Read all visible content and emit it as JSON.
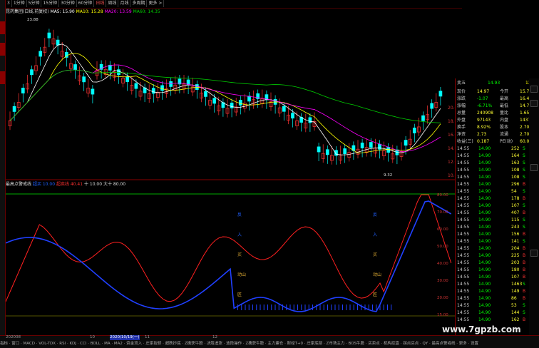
{
  "tabs": [
    "3",
    "1分钟",
    "5分钟",
    "15分钟",
    "30分钟",
    "60分钟",
    "日线",
    "周线",
    "月线",
    "多周期",
    "更多 >"
  ],
  "active_tab": "日线",
  "main_header": {
    "title": "昆药集团(日线,前复权)",
    "ma5": "MA5: 15.90",
    "ma10": "MA10: 15.28",
    "ma20": "MA20: 13.59",
    "ma60": "MA60: 14.35"
  },
  "price_axis": [
    "20.00",
    "18.00",
    "16.00",
    "14.00",
    "12.00",
    "10.00"
  ],
  "max_label": "23.88",
  "min_label": "9.32",
  "indicator_header": {
    "name": "最高点警戒线",
    "a": "超买 10.00",
    "b": "超卖线 40.41",
    "c": "十 10.00",
    "d": "大十 80.00"
  },
  "ind_axis": [
    "80.00",
    "70.00",
    "60.00",
    "50.00",
    "40.00",
    "30.00",
    "20.00",
    "15.00"
  ],
  "signals_left": [
    "反",
    "入",
    "买",
    "动山",
    "匠"
  ],
  "signals_right": [
    "反",
    "入",
    "买",
    "动山",
    "匠"
  ],
  "quote": {
    "sell5": {
      "label": "卖五",
      "price": "14.93",
      "vol": "13"
    },
    "rows": [
      {
        "k1": "现价",
        "v1": "14.97",
        "k2": "今开",
        "v2": "15.70"
      },
      {
        "k1": "涨跌",
        "v1": "-1.07",
        "k2": "最高",
        "v2": "16.40"
      },
      {
        "k1": "涨幅",
        "v1": "-6.71%",
        "k2": "最低",
        "v2": "14.70"
      },
      {
        "k1": "总量",
        "v1": "240908",
        "k2": "量比",
        "v2": "1.65"
      },
      {
        "k1": "外盘",
        "v1": "97143",
        "k2": "内盘",
        "v2": "143765"
      },
      {
        "k1": "换手",
        "v1": "8.92%",
        "k2": "股本",
        "v2": "2.70亿"
      },
      {
        "k1": "净资",
        "v1": "2.73",
        "k2": "流通",
        "v2": "2.70亿"
      },
      {
        "k1": "收益(三)",
        "v1": "0.187",
        "k2": "PE(动)",
        "v2": "60.0"
      }
    ],
    "ticks": [
      {
        "t": "14:55",
        "p": "14.90",
        "v": "252",
        "d": "S",
        "n": "5"
      },
      {
        "t": "14:55",
        "p": "14.90",
        "v": "164",
        "d": "S",
        "n": "8"
      },
      {
        "t": "14:55",
        "p": "14.90",
        "v": "163",
        "d": "S",
        "n": "8"
      },
      {
        "t": "14:55",
        "p": "14.90",
        "v": "108",
        "d": "S",
        "n": "3"
      },
      {
        "t": "14:55",
        "p": "14.90",
        "v": "108",
        "d": "S",
        "n": "9"
      },
      {
        "t": "14:55",
        "p": "14.90",
        "v": "296",
        "d": "B",
        "n": "7"
      },
      {
        "t": "14:55",
        "p": "14.90",
        "v": "54",
        "d": "S",
        "n": "8"
      },
      {
        "t": "14:55",
        "p": "14.90",
        "v": "178",
        "d": "B",
        "n": "7"
      },
      {
        "t": "14:55",
        "p": "14.90",
        "v": "107",
        "d": "S",
        "n": "3"
      },
      {
        "t": "14:55",
        "p": "14.90",
        "v": "407",
        "d": "B",
        "n": "7"
      },
      {
        "t": "14:55",
        "p": "14.90",
        "v": "115",
        "d": "S",
        "n": "7"
      },
      {
        "t": "14:55",
        "p": "14.90",
        "v": "243",
        "d": "S",
        "n": "9"
      },
      {
        "t": "14:55",
        "p": "14.90",
        "v": "156",
        "d": "B",
        "n": "5"
      },
      {
        "t": "14:55",
        "p": "14.90",
        "v": "141",
        "d": "S",
        "n": "8"
      },
      {
        "t": "14:55",
        "p": "14.90",
        "v": "204",
        "d": "B",
        "n": "1"
      },
      {
        "t": "14:55",
        "p": "14.90",
        "v": "225",
        "d": "B",
        "n": "8"
      },
      {
        "t": "14:55",
        "p": "14.90",
        "v": "203",
        "d": "B",
        "n": "3"
      },
      {
        "t": "14:55",
        "p": "14.90",
        "v": "180",
        "d": "B",
        "n": "1"
      },
      {
        "t": "14:55",
        "p": "14.90",
        "v": "107",
        "d": "B",
        "n": "1"
      },
      {
        "t": "14:55",
        "p": "14.90",
        "v": "1463",
        "d": "S",
        "n": "5"
      },
      {
        "t": "14:55",
        "p": "14.90",
        "v": "149",
        "d": "B",
        "n": "6"
      },
      {
        "t": "14:55",
        "p": "14.90",
        "v": "86",
        "d": "B",
        "n": "5"
      },
      {
        "t": "14:55",
        "p": "14.90",
        "v": "53",
        "d": "S",
        "n": "5"
      },
      {
        "t": "14:55",
        "p": "14.90",
        "v": "144",
        "d": "S",
        "n": "1"
      },
      {
        "t": "14:55",
        "p": "14.90",
        "v": "162",
        "d": "B",
        "n": "6"
      }
    ]
  },
  "date_axis": [
    "202008",
    "10",
    "11",
    "12",
    "2020/10/19(一)"
  ],
  "toolbar": "指标 · 窗口 · MACD · VOL-TDX · RSI · KDJ · CCI · BOLL · MA · MA2 · 资金流入 · 庄家抬轿 · 超跌抄底 · Z擒获牛股 · 决胜追涨 · 波段操作 · Z擒获牛股 · 主力建仓 · 财经T+0 · 庄家底部 · Z市场主力 · BOS牛股 · 买卖点 · 机构控盘 · 拐点买点 · QY · 最高点警戒线 · 更多 · 设置",
  "watermark": "www.7gpzb.com",
  "colors": {
    "up": "#ff3333",
    "down": "#00ffff",
    "ma5": "#ffffff",
    "ma10": "#ffff00",
    "ma20": "#ff00ff",
    "ma60": "#00cc00",
    "red_line": "#ff2020",
    "blue_line": "#2040ff"
  }
}
